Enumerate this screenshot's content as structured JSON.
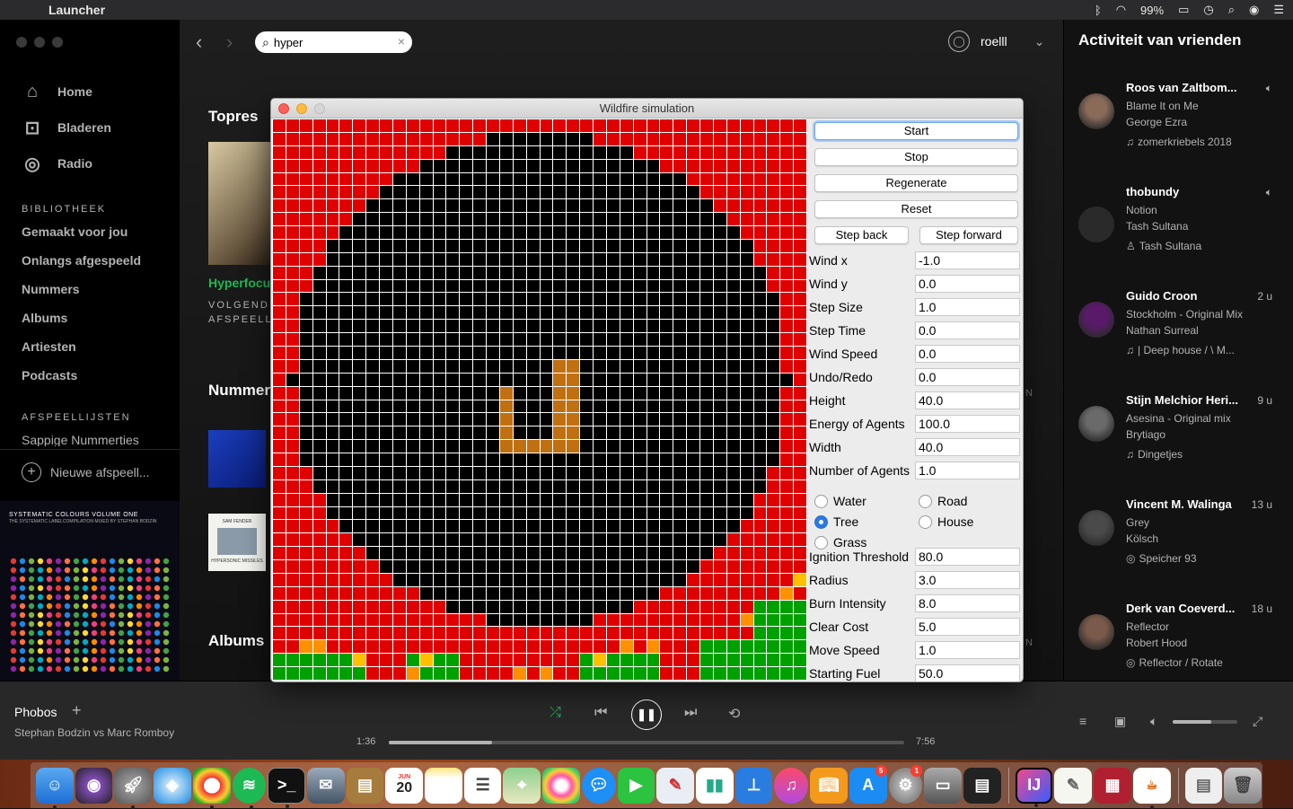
{
  "menubar": {
    "app_name": "Launcher",
    "battery": "99%"
  },
  "sidebar": {
    "nav": [
      {
        "label": "Home",
        "icon": "home-icon"
      },
      {
        "label": "Bladeren",
        "icon": "browse-icon"
      },
      {
        "label": "Radio",
        "icon": "radio-icon"
      }
    ],
    "library_title": "BIBLIOTHEEK",
    "library": [
      "Gemaakt voor jou",
      "Onlangs afgespeeld",
      "Nummers",
      "Albums",
      "Artiesten",
      "Podcasts"
    ],
    "playlists_title": "AFSPEELLIJSTEN",
    "playlists": [
      "Sappige Nummerties"
    ],
    "new_playlist": "Nieuwe afspeell...",
    "cover_title": "SYSTEMATIC COLOURS VOLUME ONE",
    "cover_sub": "THE SYSTEMATIC LABELCOMPILATION MIXED BY STEPHAN BODZIN"
  },
  "main": {
    "search_value": "hyper",
    "username": "roelll",
    "top_heading": "Topres",
    "top_name": "Hyperfocu",
    "top_sub1": "VOLGEND",
    "top_sub2": "AFSPEELLI",
    "tracks_heading": "Nummer",
    "albums_heading": "Albums",
    "edge_n": "N",
    "thumb2_text": "SAM FENDER",
    "thumb2_sub": "HYPERSONIC MISSILES"
  },
  "friends": {
    "title": "Activiteit van vrienden",
    "items": [
      {
        "name": "Roos van Zaltbom...",
        "time": "",
        "track": "Blame It on Me",
        "artist": "George Ezra",
        "context": "zomerkriebels 2018",
        "ctx_icon": "♫",
        "playing": true,
        "avatar": "#8a6b5a"
      },
      {
        "name": "thobundy",
        "time": "",
        "track": "Notion",
        "artist": "Tash Sultana",
        "context": "Tash Sultana",
        "ctx_icon": "♙",
        "playing": true,
        "avatar": "#2a2a2a"
      },
      {
        "name": "Guido Croon",
        "time": "2 u",
        "track": "Stockholm - Original Mix",
        "artist": "Nathan Surreal",
        "context": "| Deep house / \\ M...",
        "ctx_icon": "♫",
        "playing": false,
        "avatar": "#5a1a6a"
      },
      {
        "name": "Stijn Melchior Heri...",
        "time": "9 u",
        "track": "Asesina - Original mix",
        "artist": "Brytiago",
        "context": "Dingetjes",
        "ctx_icon": "♫",
        "playing": false,
        "avatar": "#6a6a6a"
      },
      {
        "name": "Vincent M. Walinga",
        "time": "13 u",
        "track": "Grey",
        "artist": "Kölsch",
        "context": "Speicher 93",
        "ctx_icon": "◎",
        "playing": false,
        "avatar": "#4a4a4a"
      },
      {
        "name": "Derk van Coeverd...",
        "time": "18 u",
        "track": "Reflector",
        "artist": "Robert Hood",
        "context": "Reflector / Rotate",
        "ctx_icon": "◎",
        "playing": false,
        "avatar": "#7a5a4a"
      }
    ]
  },
  "player": {
    "title": "Phobos",
    "artist": "Stephan Bodzin vs Marc Romboy",
    "time_current": "1:36",
    "time_total": "7:56",
    "progress": 0.2,
    "volume": 0.6
  },
  "sim": {
    "title": "Wildfire simulation",
    "buttons": {
      "start": "Start",
      "stop": "Stop",
      "regenerate": "Regenerate",
      "reset": "Reset",
      "step_back": "Step back",
      "step_forward": "Step forward"
    },
    "fields1": [
      {
        "label": "Wind x",
        "value": "-1.0"
      },
      {
        "label": "Wind y",
        "value": "0.0"
      },
      {
        "label": "Step Size",
        "value": "1.0"
      },
      {
        "label": "Step Time",
        "value": "0.0"
      },
      {
        "label": "Wind Speed",
        "value": "0.0"
      },
      {
        "label": "Undo/Redo",
        "value": "0.0"
      },
      {
        "label": "Height",
        "value": "40.0"
      },
      {
        "label": "Energy of Agents",
        "value": "100.0"
      },
      {
        "label": "Width",
        "value": "40.0"
      },
      {
        "label": "Number of Agents",
        "value": "1.0"
      }
    ],
    "radios": {
      "water": "Water",
      "road": "Road",
      "tree": "Tree",
      "house": "House",
      "grass": "Grass",
      "selected": "Tree"
    },
    "fields2": [
      {
        "label": "Ignition Threshold",
        "value": "80.0"
      },
      {
        "label": "Radius",
        "value": "3.0"
      },
      {
        "label": "Burn Intensity",
        "value": "8.0"
      },
      {
        "label": "Clear Cost",
        "value": "5.0"
      },
      {
        "label": "Move Speed",
        "value": "1.0"
      },
      {
        "label": "Starting Fuel",
        "value": "50.0"
      }
    ]
  },
  "dock": {
    "calendar_month": "JUN",
    "calendar_day": "20",
    "appstore_badge": "5",
    "prefs_badge": "1"
  }
}
